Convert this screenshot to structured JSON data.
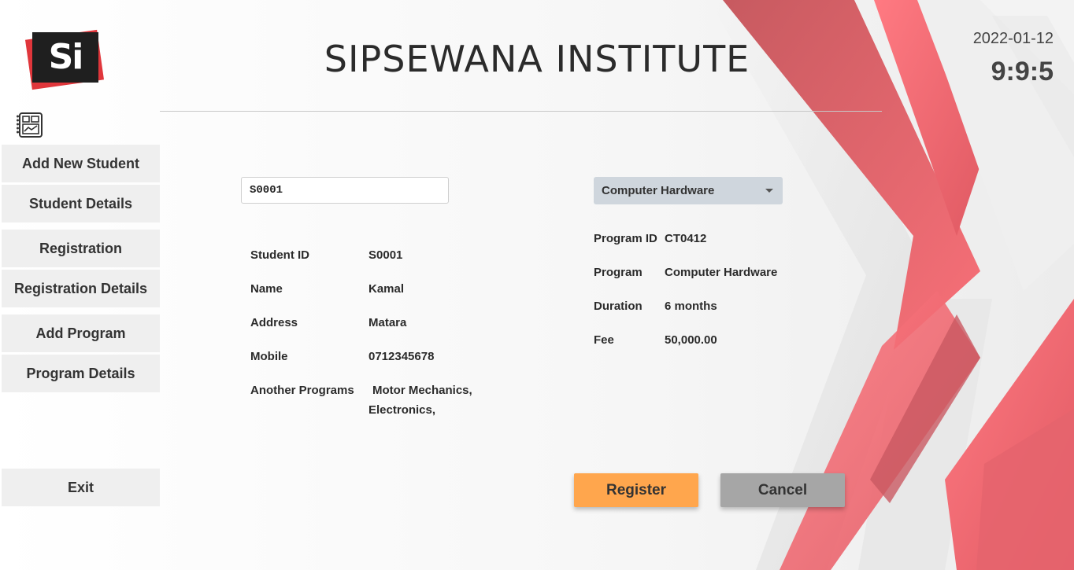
{
  "header": {
    "logo_text": "Si",
    "title": "SIPSEWANA INSTITUTE",
    "date": "2022-01-12",
    "time": "9:9:5"
  },
  "sidebar": {
    "items": [
      {
        "label": "Add New Student"
      },
      {
        "label": "Student Details"
      },
      {
        "label": "Registration"
      },
      {
        "label": "Registration Details"
      },
      {
        "label": "Add Program"
      },
      {
        "label": "Program Details"
      }
    ],
    "exit_label": "Exit"
  },
  "student": {
    "search_value": "S0001",
    "fields": [
      {
        "label": "Student ID",
        "value": "S0001"
      },
      {
        "label": "Name",
        "value": "Kamal"
      },
      {
        "label": "Address",
        "value": "Matara"
      },
      {
        "label": "Mobile",
        "value": "0712345678"
      },
      {
        "label": "Another Programs",
        "value": "Motor Mechanics,",
        "value2": "Electronics,"
      }
    ]
  },
  "program": {
    "selected": "Computer Hardware",
    "fields": [
      {
        "label": "Program ID",
        "value": "CT0412"
      },
      {
        "label": "Program",
        "value": "Computer Hardware"
      },
      {
        "label": "Duration",
        "value": "6 months"
      },
      {
        "label": "Fee",
        "value": "50,000.00"
      }
    ]
  },
  "actions": {
    "register_label": "Register",
    "cancel_label": "Cancel"
  },
  "colors": {
    "accent_red": "#f36a73",
    "register_orange": "#ffa64d",
    "cancel_gray": "#a6a6a6",
    "nav_bg": "#efefef"
  },
  "icons": {
    "logo": "si-logo",
    "dashboard": "dashboard-icon",
    "dropdown": "chevron-down-icon"
  }
}
